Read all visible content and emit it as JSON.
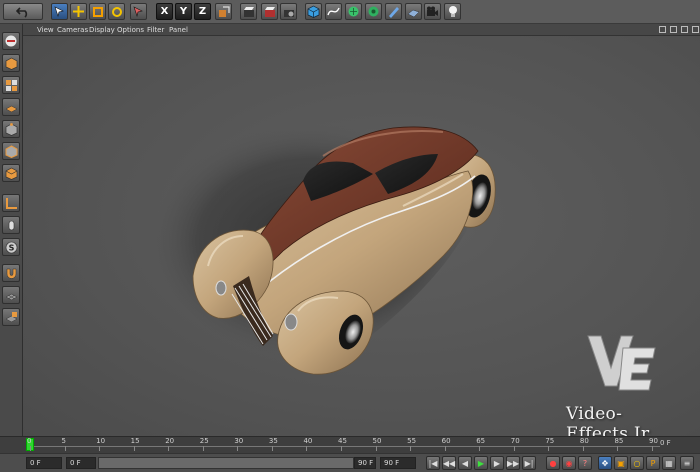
{
  "viewport_menu": {
    "items": [
      "View",
      "Cameras",
      "Display",
      "Options",
      "Filter",
      "Panel"
    ]
  },
  "toolbar": {
    "x_label": "X",
    "y_label": "Y",
    "z_label": "Z"
  },
  "timeline": {
    "ticks": [
      "0",
      "5",
      "10",
      "15",
      "20",
      "25",
      "30",
      "35",
      "40",
      "45",
      "50",
      "55",
      "60",
      "65",
      "70",
      "75",
      "80",
      "85",
      "90"
    ],
    "end_label": "0 F"
  },
  "transport": {
    "current_frame": "0 F",
    "start_frame": "0 F",
    "slider_end": "90 F",
    "end_frame": "90 F"
  },
  "watermark": {
    "text": "Video-Effects.Ir"
  },
  "colors": {
    "viewport_bg": "#575757",
    "car_body": "#c8ab82",
    "car_roof": "#6e3a2a",
    "playhead": "#2fd62f"
  },
  "icons": {
    "toolbar": [
      "undo-icon",
      "live-selection-icon",
      "move-icon",
      "scale-icon",
      "rotate-icon",
      "selection-icon",
      "x-axis-icon",
      "y-axis-icon",
      "z-axis-icon",
      "coordinate-system-icon",
      "render-view-icon",
      "render-picture-viewer-icon",
      "render-settings-icon",
      "cube-icon",
      "spline-pen-icon",
      "subdivision-icon",
      "array-icon",
      "deformer-icon",
      "floor-icon",
      "camera-icon",
      "light-icon"
    ],
    "left_palette": [
      "make-editable-icon",
      "model-mode-icon",
      "texture-mode-icon",
      "workplane-icon",
      "points-mode-icon",
      "edges-mode-icon",
      "polygons-mode-icon",
      "axis-mode-icon",
      "tweak-mode-icon",
      "snapping-icon",
      "magnet-icon",
      "workplane-grid-icon",
      "lock-workplane-icon"
    ]
  }
}
